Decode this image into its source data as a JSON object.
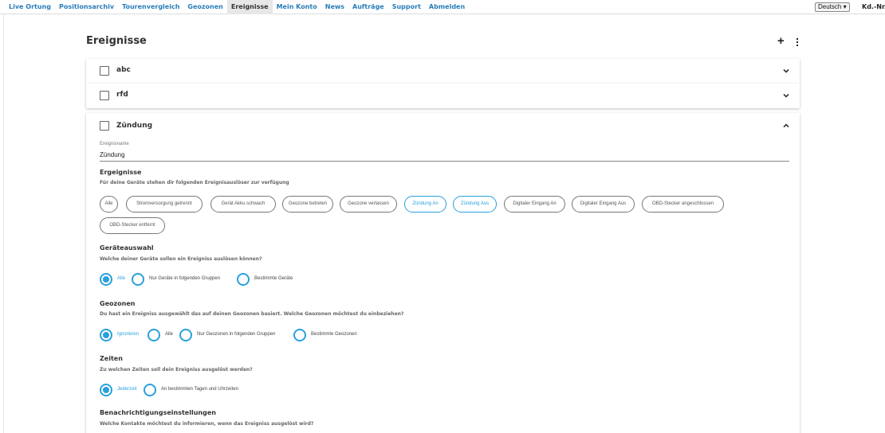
{
  "nav": {
    "items": [
      "Live Ortung",
      "Positionsarchiv",
      "Tourenvergleich",
      "Geozonen",
      "Ereignisse",
      "Mein Konto",
      "News",
      "Aufträge",
      "Support",
      "Abmelden"
    ],
    "language": "Deutsch ▾",
    "customer_no": "Kd.-Nr."
  },
  "page": {
    "title": "Ereignisse",
    "add_symbol": "+"
  },
  "events": [
    {
      "name": "abc"
    },
    {
      "name": "rfd"
    },
    {
      "name": "Zündung"
    }
  ],
  "editor": {
    "name_label": "Ereignisname",
    "name_value": "Zündung",
    "triggers": {
      "title": "Ergeignisse",
      "desc": "Für deine Geräte stehen dir folgenden Ereignisauslöser zur verfügung",
      "chips": [
        "Alle",
        "Stromversorgung getrennt",
        "Gerät Akku schwach",
        "Geozone betreten",
        "Geozone verlassen",
        "Zündung An",
        "Zündung Aus",
        "Digitaler Eingang An",
        "Digitaler Eingang Aus",
        "OBD-Stecker angeschlossen",
        "OBD-Stecker entfernt"
      ],
      "selected": [
        "Zündung An",
        "Zündung Aus"
      ]
    },
    "devices": {
      "title": "Geräteauswahl",
      "desc": "Welche deiner Geräte sollen ein Ereigniss auslösen können?",
      "options": [
        "Alle",
        "Nur Geräte in folgenden Gruppen",
        "Bestimmte Geräte"
      ],
      "selected": "Alle"
    },
    "geozones": {
      "title": "Geozonen",
      "desc": "Du hast ein Ereigniss ausgewählt das auf deinen Geozonen basiert. Welche Geozonen möchtest du einbeziehen?",
      "options": [
        "Ignorieren",
        "Alle",
        "Nur Geozonen in folgenden Gruppen",
        "Bestimmte Geozonen"
      ],
      "selected": "Ignorieren"
    },
    "times": {
      "title": "Zeiten",
      "desc": "Zu welchen Zeiten soll dein Ereigniss ausgelöst werden?",
      "options": [
        "Jederzeit",
        "An bestimmten Tagen und Uhrzeiten"
      ],
      "selected": "Jederzeit"
    },
    "notify": {
      "title": "Benachrichtigungseinstellungen",
      "desc": "Welche Kontakte möchtest du informieren, wenn das Ereigniss ausgelöst wird?"
    }
  }
}
